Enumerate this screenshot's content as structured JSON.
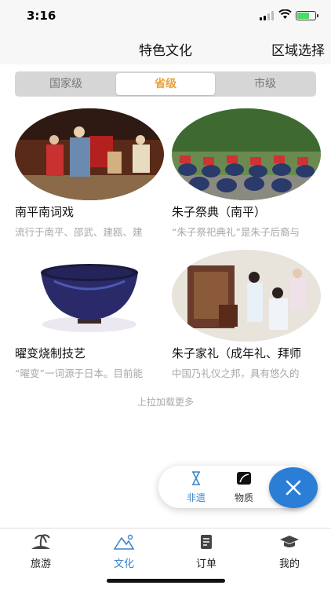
{
  "status": {
    "time": "3:16"
  },
  "header": {
    "title": "特色文化",
    "region_label": "区域选择"
  },
  "segments": [
    {
      "label": "国家级",
      "active": false
    },
    {
      "label": "省级",
      "active": true
    },
    {
      "label": "市级",
      "active": false
    }
  ],
  "items": [
    {
      "name": "南平南词戏",
      "desc": "流行于南平、邵武、建瓯、建"
    },
    {
      "name": "朱子祭典（南平）",
      "desc": "“朱子祭祀典礼”是朱子后裔与"
    },
    {
      "name": "曜变烧制技艺",
      "desc": "“曜变”一词源于日本。目前能"
    },
    {
      "name": "朱子家礼（成年礼、拜师",
      "desc": "中国乃礼仪之邦，具有悠久的"
    }
  ],
  "load_more": "上拉加载更多",
  "fab": {
    "items": [
      {
        "label": "非遗",
        "icon": "hourglass-icon",
        "active": true
      },
      {
        "label": "物质",
        "icon": "leaf-icon",
        "active": false
      }
    ],
    "close_icon": "close-icon"
  },
  "tabbar": [
    {
      "label": "旅游",
      "icon": "island-icon",
      "active": false
    },
    {
      "label": "文化",
      "icon": "mountain-icon",
      "active": true
    },
    {
      "label": "订单",
      "icon": "document-icon",
      "active": false
    },
    {
      "label": "我的",
      "icon": "graduation-cap-icon",
      "active": false
    }
  ],
  "colors": {
    "accent": "#e8a23a",
    "primary": "#2b7ed6",
    "tab_active": "#3c84c8"
  }
}
